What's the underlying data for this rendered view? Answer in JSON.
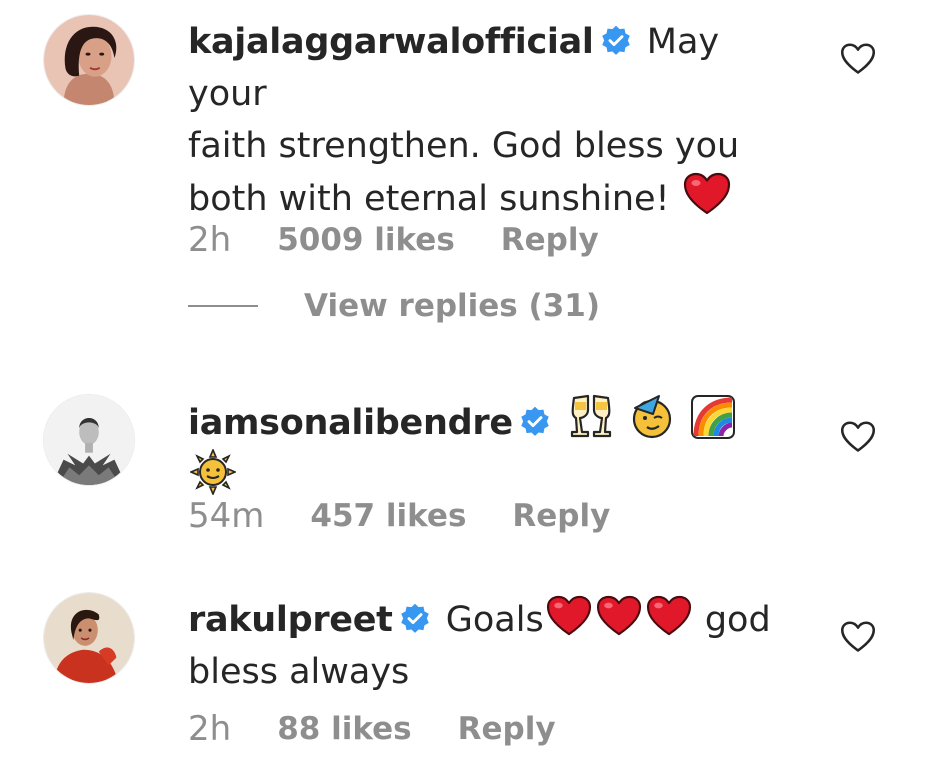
{
  "comments": [
    {
      "username": "kajalaggarwalofficial",
      "text_line1": "May your",
      "text_line2": "faith strengthen. God bless you",
      "text_line3": "both with eternal sunshine!",
      "time": "2h",
      "likes": "5009 likes",
      "reply": "Reply",
      "view_replies": "View replies (31)",
      "emojis": [
        "red-heart"
      ]
    },
    {
      "username": "iamsonalibendre",
      "text": "",
      "time": "54m",
      "likes": "457 likes",
      "reply": "Reply",
      "emojis": [
        "clinking-glasses",
        "partying-face",
        "rainbow",
        "sun-with-face"
      ]
    },
    {
      "username": "rakulpreet",
      "text_before": "Goals",
      "text_after": "god",
      "text_line2": "bless always",
      "time": "2h",
      "likes": "88 likes",
      "reply": "Reply",
      "emojis": [
        "red-heart",
        "red-heart",
        "red-heart"
      ]
    }
  ],
  "colors": {
    "text": "#262626",
    "secondary": "#8e8e8e",
    "verified": "#3897f0",
    "heart_red": "#e0182a"
  }
}
